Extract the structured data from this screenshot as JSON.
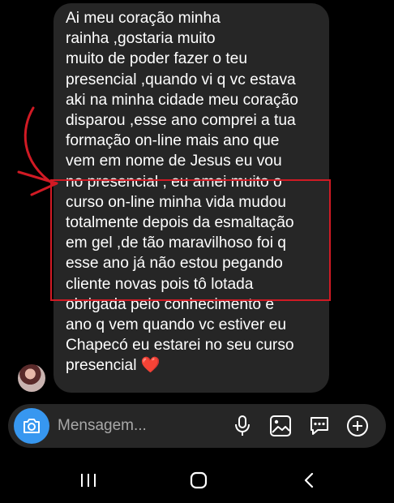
{
  "message": {
    "lines": [
      "Ai meu coração minha",
      "rainha ,gostaria muito",
      "muito de poder fazer o teu",
      "presencial ,quando vi q vc estava",
      "aki na minha cidade meu coração",
      "disparou ,esse ano comprei a tua",
      "formação on-line mais ano que",
      "vem em nome de Jesus eu vou",
      "no presencial , eu amei muito o",
      "curso on-line minha vida mudou",
      "totalmente depois da esmaltação",
      "em gel ,de tão maravilhoso foi q",
      "esse ano já não estou pegando",
      "cliente novas pois tô lotada",
      "obrigada pelo conhecimento e",
      "ano q vem quando vc estiver eu",
      "Chapecó eu estarei no seu curso",
      "presencial ❤️"
    ],
    "highlighted_line_range": [
      9,
      14
    ]
  },
  "composer": {
    "placeholder": "Mensagem..."
  },
  "colors": {
    "background": "#000000",
    "bubble": "#262626",
    "camera_button": "#3797f0",
    "annotation": "#d11a24",
    "heart": "#e0102a"
  },
  "icons": {
    "camera": "camera-icon",
    "mic": "microphone-icon",
    "gallery": "gallery-icon",
    "sticker": "sticker-icon",
    "plus": "plus-icon",
    "nav_recent": "recent-apps-icon",
    "nav_home": "home-icon",
    "nav_back": "back-icon"
  }
}
